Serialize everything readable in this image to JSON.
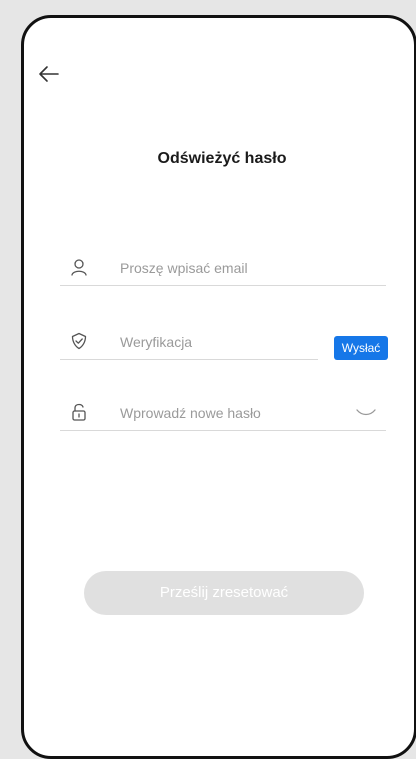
{
  "header": {
    "back_icon": "arrow-left-icon",
    "title": "Odświeżyć hasło"
  },
  "form": {
    "email": {
      "icon": "user-icon",
      "value": "",
      "placeholder": "Proszę wpisać email"
    },
    "verification": {
      "icon": "shield-check-icon",
      "value": "",
      "placeholder": "Weryfikacja",
      "send_label": "Wysłać"
    },
    "new_password": {
      "icon": "unlock-icon",
      "value": "",
      "placeholder": "Wprowadź nowe hasło",
      "toggle_icon": "eye-closed-icon"
    },
    "submit_label": "Prześlij zresetować"
  },
  "colors": {
    "accent": "#1677e8",
    "submit_disabled": "#e0e0e0",
    "placeholder": "#9a9a9a",
    "divider": "#d9d9d9"
  }
}
